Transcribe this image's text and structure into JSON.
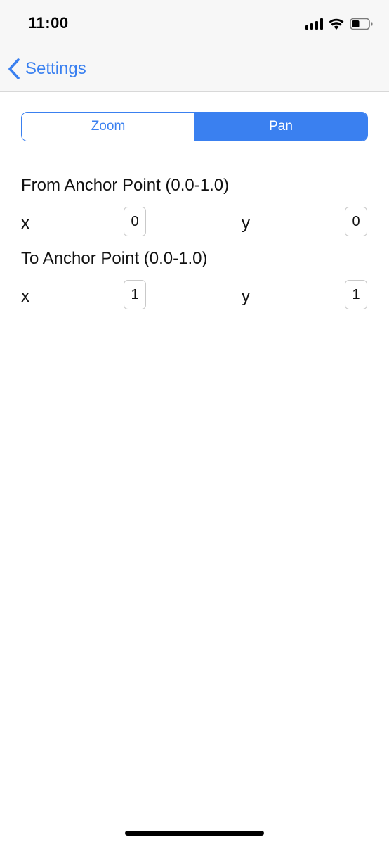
{
  "status_bar": {
    "time": "11:00",
    "icons": [
      "signal-icon",
      "wifi-icon",
      "battery-icon"
    ]
  },
  "nav": {
    "back_label": "Settings",
    "back_icon": "chevron-left-icon"
  },
  "segmented_control": {
    "segments": [
      "Zoom",
      "Pan"
    ],
    "selected": "Pan"
  },
  "from_anchor": {
    "title": "From Anchor Point (0.0-1.0)",
    "x_label": "x",
    "x_value": "0",
    "y_label": "y",
    "y_value": "0"
  },
  "to_anchor": {
    "title": "To Anchor Point (0.0-1.0)",
    "x_label": "x",
    "x_value": "1",
    "y_label": "y",
    "y_value": "1"
  },
  "colors": {
    "accent": "#3a80f0",
    "bar_background": "#f7f7f7"
  }
}
